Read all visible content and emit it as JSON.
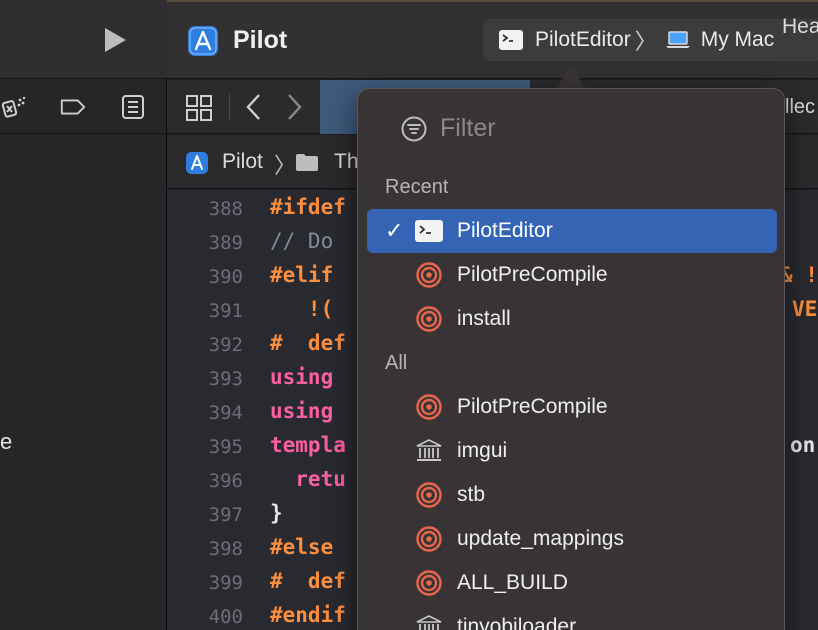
{
  "toolbar": {
    "project_title": "Pilot",
    "scheme": "PilotEditor",
    "destination": "My Mac"
  },
  "tabbar": {
    "right_text": "llec"
  },
  "jumpbar": {
    "project": "Pilot",
    "folder": "Th",
    "right_text": "Hea"
  },
  "left_pane": {
    "stub_text": "e"
  },
  "editor": {
    "lines": [
      {
        "n": "388",
        "text": "#ifdef",
        "cls": "c-prep"
      },
      {
        "n": "389",
        "text": "// Do",
        "cls": "c-comment"
      },
      {
        "n": "390",
        "text": "#elif",
        "cls": "c-prep"
      },
      {
        "n": "391",
        "text": "   !(",
        "cls": "c-prep"
      },
      {
        "n": "392",
        "text": "#  def",
        "cls": "c-prep"
      },
      {
        "n": "393",
        "text": "using",
        "cls": "c-kw"
      },
      {
        "n": "394",
        "text": "using",
        "cls": "c-kw"
      },
      {
        "n": "395",
        "text": "templa",
        "cls": "c-kw"
      },
      {
        "n": "396",
        "text": "  retu",
        "cls": "c-kw"
      },
      {
        "n": "397",
        "text": "}",
        "cls": "c-plain"
      },
      {
        "n": "398",
        "text": "#else",
        "cls": "c-prep"
      },
      {
        "n": "399",
        "text": "#  def",
        "cls": "c-prep"
      },
      {
        "n": "400",
        "text": "#endif",
        "cls": "c-prep"
      }
    ],
    "right_fragments": [
      {
        "line": "390",
        "text": "& !",
        "cls": "c-prep"
      },
      {
        "line": "391",
        "text": "VE",
        "cls": "c-prep"
      },
      {
        "line": "395",
        "text": "on",
        "cls": "c-plain"
      }
    ]
  },
  "popover": {
    "filter_placeholder": "Filter",
    "recent_label": "Recent",
    "all_label": "All",
    "recent": [
      {
        "label": "PilotEditor",
        "icon": "terminal-icon",
        "selected": true
      },
      {
        "label": "PilotPreCompile",
        "icon": "target-icon"
      },
      {
        "label": "install",
        "icon": "target-icon"
      }
    ],
    "all": [
      {
        "label": "PilotPreCompile",
        "icon": "target-icon"
      },
      {
        "label": "imgui",
        "icon": "library-icon"
      },
      {
        "label": "stb",
        "icon": "target-icon"
      },
      {
        "label": "update_mappings",
        "icon": "target-icon"
      },
      {
        "label": "ALL_BUILD",
        "icon": "target-icon"
      },
      {
        "label": "tinyobjloader",
        "icon": "library-icon"
      }
    ]
  },
  "colors": {
    "selection": "#3464b3",
    "target_icon": "#e8674b",
    "preprocessor": "#fd8f3f",
    "keyword": "#fc5fa3",
    "comment": "#7f8c98"
  }
}
